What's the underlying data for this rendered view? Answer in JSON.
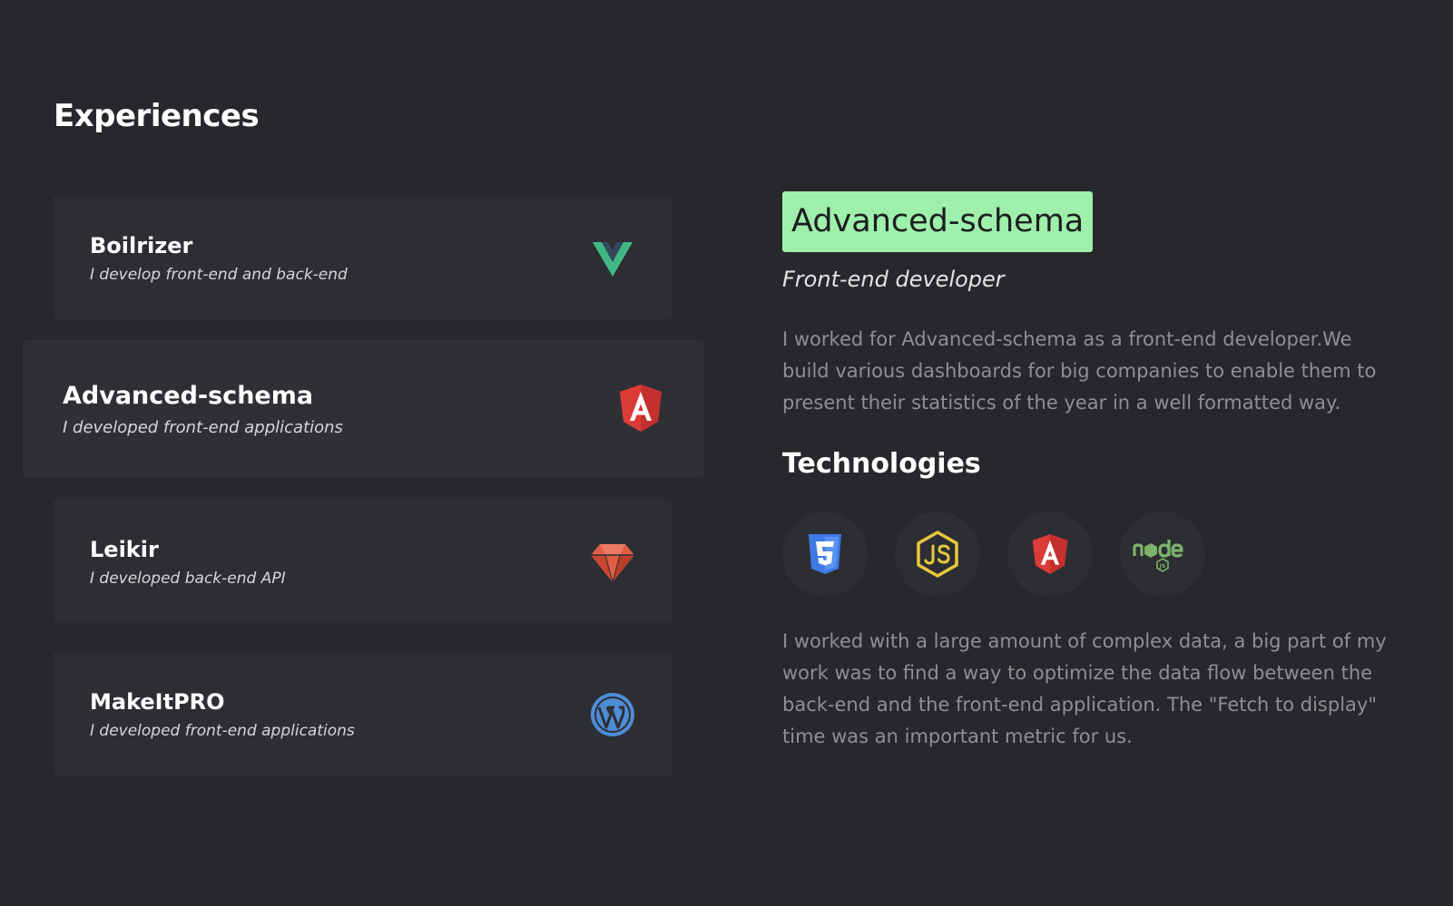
{
  "section_title": "Experiences",
  "experiences": [
    {
      "name": "Boilrizer",
      "description": "I develop front-end and back-end",
      "logo": "vue-icon",
      "color": "#41b883"
    },
    {
      "name": "Advanced-schema",
      "description": "I developed front-end applications",
      "logo": "angular-icon",
      "color": "#dd3b37",
      "active": true
    },
    {
      "name": "Leikir",
      "description": "I developed back-end API",
      "logo": "gem-icon",
      "color": "#e05d44"
    },
    {
      "name": "MakeItPRO",
      "description": "I developed front-end applications",
      "logo": "wordpress-icon",
      "color": "#4f8cd6"
    }
  ],
  "detail": {
    "company": "Advanced-schema",
    "role": "Front-end developer",
    "description": "I worked for Advanced-schema as a front-end developer.We build various dashboards for big companies to enable them to present their statistics of the year in a well formatted way.",
    "technologies_title": "Technologies",
    "technologies": [
      {
        "icon": "css3-icon",
        "color": "#3d7ae6"
      },
      {
        "icon": "javascript-icon",
        "color": "#e8c83e"
      },
      {
        "icon": "angular-icon",
        "color": "#dd3b37"
      },
      {
        "icon": "nodejs-icon",
        "color": "#7bb36a"
      }
    ],
    "work_description": "I worked with a large amount of complex data, a big part of my work was to find a way to optimize the data flow between the back-end and the front-end application. The \"Fetch to display\" time was an important metric for us."
  },
  "colors": {
    "background": "#27282c",
    "card": "#2d2e33",
    "accent": "#9ef0aa"
  }
}
